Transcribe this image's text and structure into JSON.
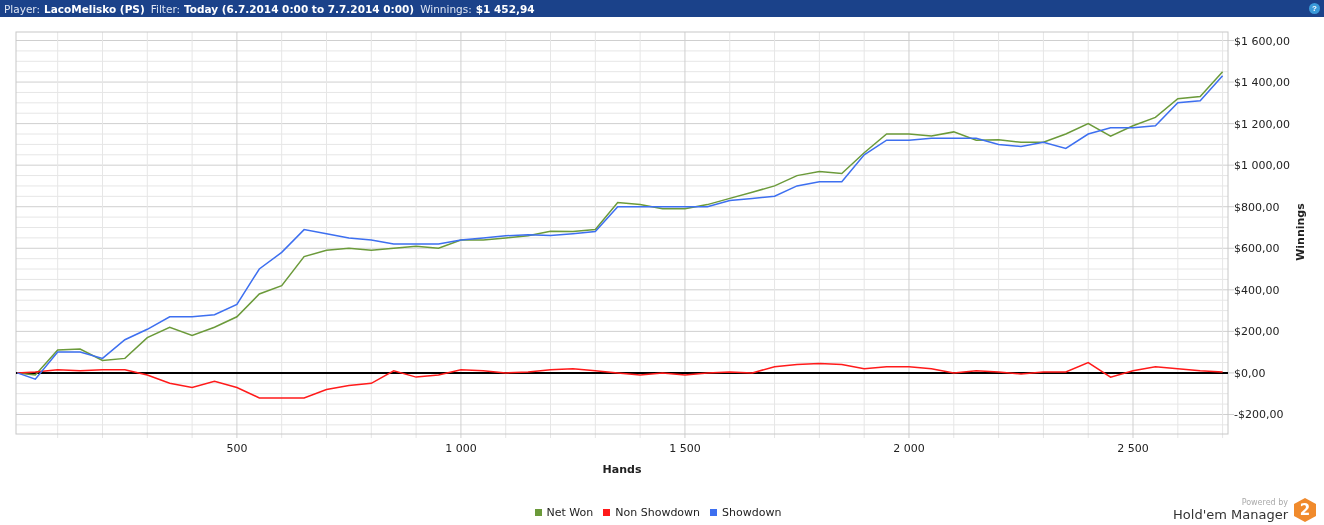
{
  "header": {
    "fields": [
      {
        "label": "Player:",
        "value": "LacoMelisko (PS)"
      },
      {
        "label": "Filter:",
        "value": "Today (6.7.2014 0:00 to 7.7.2014 0:00)"
      },
      {
        "label": "Winnings:",
        "value": "$1 452,94"
      }
    ],
    "help": "?"
  },
  "chart": {
    "chart_data": {
      "type": "line",
      "xlabel": "Hands",
      "ylabel": "Winnings",
      "x": [
        10,
        50,
        100,
        150,
        200,
        250,
        300,
        350,
        400,
        450,
        500,
        550,
        600,
        650,
        700,
        750,
        800,
        850,
        900,
        950,
        1000,
        1050,
        1100,
        1150,
        1200,
        1250,
        1300,
        1350,
        1400,
        1450,
        1500,
        1550,
        1600,
        1650,
        1700,
        1750,
        1800,
        1850,
        1900,
        1950,
        2000,
        2050,
        2100,
        2150,
        2200,
        2250,
        2300,
        2350,
        2400,
        2450,
        2500,
        2550,
        2600,
        2650,
        2700
      ],
      "series": [
        {
          "name": "Net Won",
          "color": "#6b9a3a",
          "values": [
            0,
            -10,
            110,
            115,
            60,
            70,
            170,
            220,
            180,
            220,
            270,
            380,
            420,
            560,
            590,
            600,
            590,
            600,
            610,
            600,
            640,
            640,
            650,
            660,
            682,
            680,
            690,
            820,
            810,
            790,
            790,
            810,
            840,
            870,
            900,
            950,
            970,
            960,
            1060,
            1150,
            1150,
            1140,
            1160,
            1120,
            1122,
            1110,
            1110,
            1150,
            1200,
            1140,
            1190,
            1230,
            1320,
            1330,
            1450
          ]
        },
        {
          "name": "Non Showdown",
          "color": "#ff1a1a",
          "values": [
            0,
            5,
            15,
            10,
            15,
            15,
            -10,
            -50,
            -70,
            -40,
            -70,
            -120,
            -120,
            -120,
            -80,
            -60,
            -50,
            10,
            -20,
            -10,
            15,
            10,
            0,
            5,
            15,
            20,
            10,
            0,
            -10,
            0,
            -10,
            0,
            5,
            0,
            30,
            40,
            45,
            40,
            20,
            30,
            30,
            20,
            0,
            10,
            5,
            -5,
            5,
            5,
            50,
            -20,
            10,
            30,
            20,
            10,
            5
          ]
        },
        {
          "name": "Showdown",
          "color": "#3d6ff0",
          "values": [
            0,
            -30,
            100,
            100,
            70,
            160,
            210,
            270,
            270,
            280,
            330,
            500,
            580,
            690,
            670,
            650,
            640,
            620,
            620,
            620,
            640,
            650,
            660,
            665,
            662,
            670,
            680,
            800,
            800,
            800,
            800,
            800,
            830,
            840,
            850,
            900,
            920,
            920,
            1050,
            1120,
            1120,
            1130,
            1130,
            1130,
            1100,
            1090,
            1110,
            1080,
            1150,
            1180,
            1180,
            1190,
            1300,
            1310,
            1430
          ]
        }
      ],
      "grid": true,
      "xlim": [
        7,
        2712
      ],
      "ylim": [
        -294,
        1641
      ],
      "xticks": [
        {
          "value": 500,
          "label": "500"
        },
        {
          "value": 1000,
          "label": "1 000"
        },
        {
          "value": 1500,
          "label": "1 500"
        },
        {
          "value": 2000,
          "label": "2 000"
        },
        {
          "value": 2500,
          "label": "2 500"
        }
      ],
      "yticks": [
        {
          "value": -200,
          "label": "-$200,00"
        },
        {
          "value": 0,
          "label": "$0,00"
        },
        {
          "value": 200,
          "label": "$200,00"
        },
        {
          "value": 400,
          "label": "$400,00"
        },
        {
          "value": 600,
          "label": "$600,00"
        },
        {
          "value": 800,
          "label": "$800,00"
        },
        {
          "value": 1000,
          "label": "$1 000,00"
        },
        {
          "value": 1200,
          "label": "$1 200,00"
        },
        {
          "value": 1400,
          "label": "$1 400,00"
        },
        {
          "value": 1600,
          "label": "$1 600,00"
        }
      ]
    }
  },
  "brand": {
    "tagline": "Powered by",
    "name": "Hold'em Manager",
    "logo_text": "2"
  }
}
